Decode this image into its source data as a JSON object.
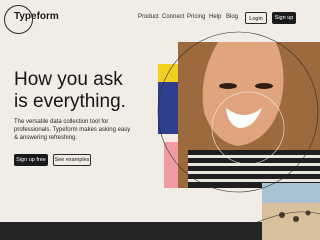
{
  "header": {
    "brand": "Typeform",
    "nav": [
      "Product",
      "Connect",
      "Pricing",
      "Help",
      "Blog"
    ],
    "login_label": "Login",
    "signup_label": "Sign up"
  },
  "hero": {
    "headline_line1": "How you ask",
    "headline_line2": "is everything.",
    "subtext": "The versatile data collection tool for professionals. Typeform makes asking easy & answering refreshing.",
    "primary_cta": "Sign up free",
    "secondary_cta": "See examples"
  },
  "colors": {
    "background": "#f1ede6",
    "primary_button": "#1a1a1a",
    "accent_yellow": "#f2cf1f",
    "accent_blue": "#2e3f8f",
    "accent_pink": "#f19ca2"
  }
}
